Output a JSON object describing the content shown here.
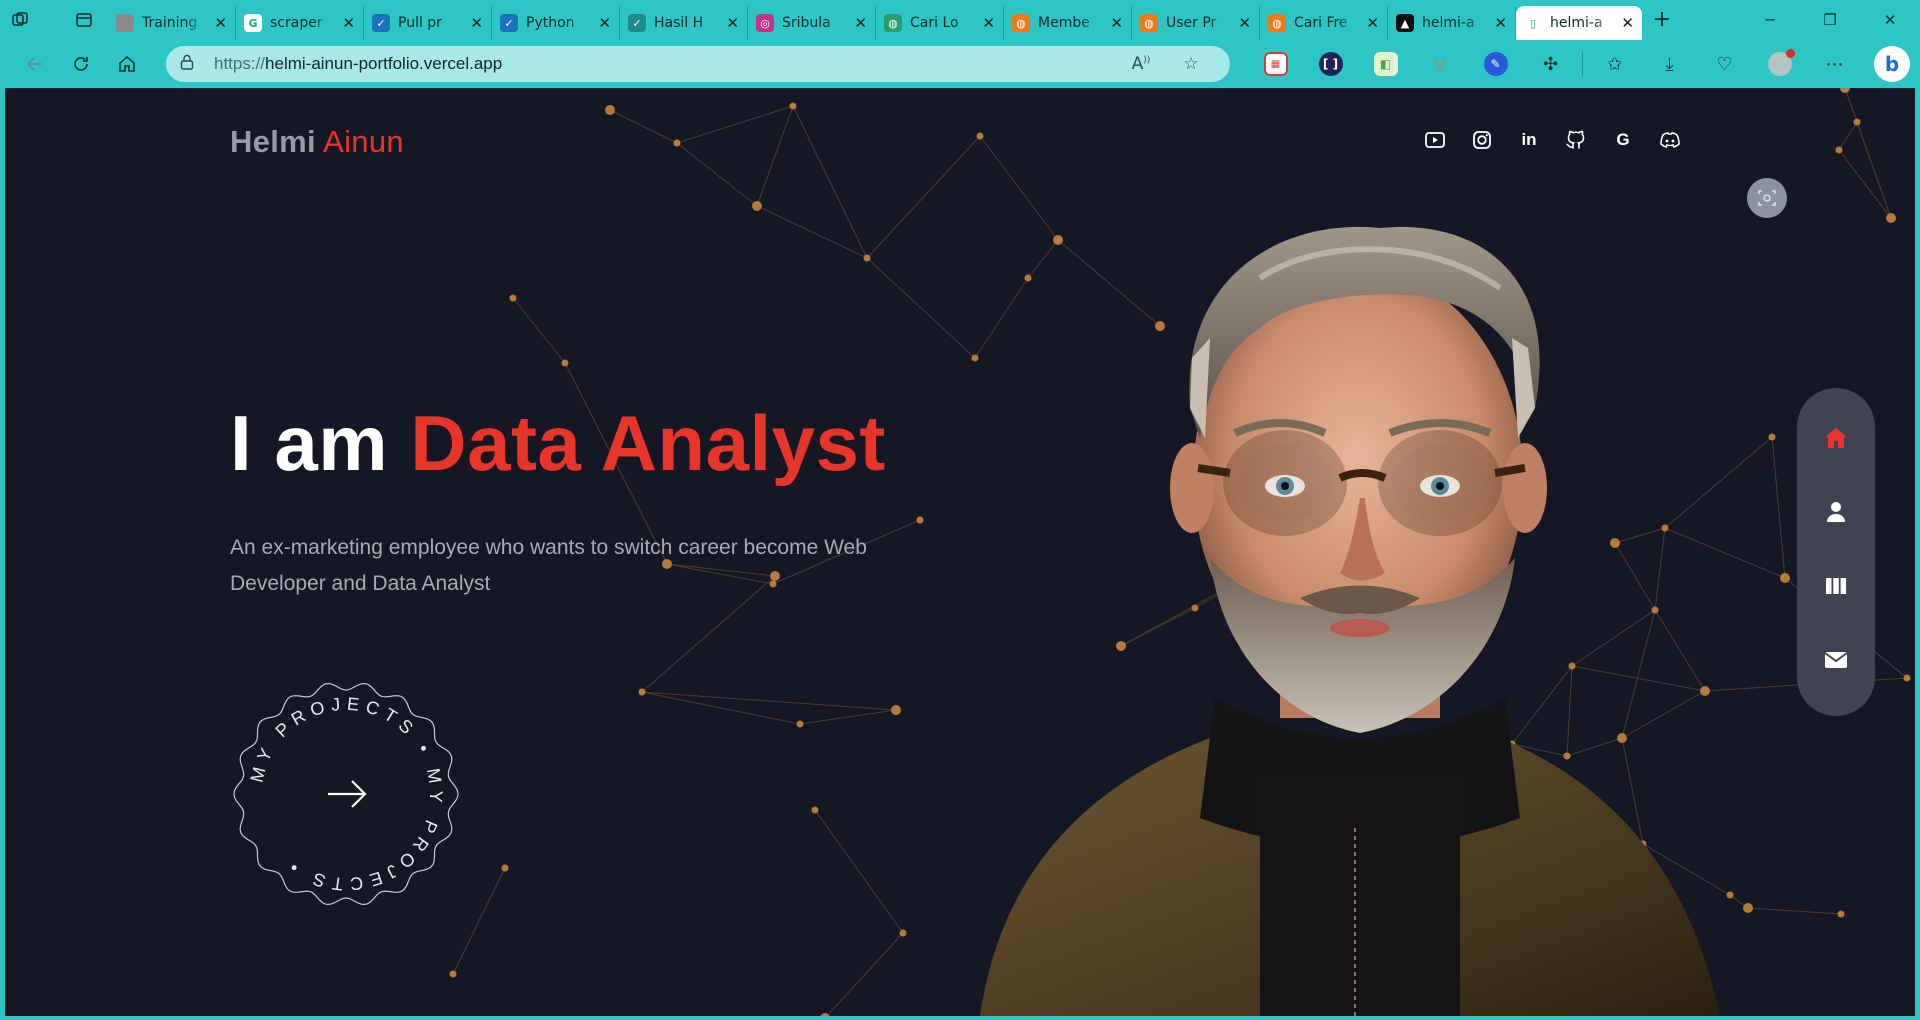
{
  "browser": {
    "tabs": [
      {
        "title": "Training",
        "favicon_color": "#8a8a8a",
        "glyph": "",
        "active": false
      },
      {
        "title": "scraper",
        "favicon_color": "#ffffff",
        "glyph": "G",
        "active": false
      },
      {
        "title": "Pull pr",
        "favicon_color": "#1a73b8",
        "glyph": "✓",
        "active": false
      },
      {
        "title": "Python",
        "favicon_color": "#1a73b8",
        "glyph": "✓",
        "active": false
      },
      {
        "title": "Hasil H",
        "favicon_color": "#1f8a8a",
        "glyph": "✓",
        "active": false
      },
      {
        "title": "Sribula",
        "favicon_color": "#c13584",
        "glyph": "◎",
        "active": false
      },
      {
        "title": "Cari Lo",
        "favicon_color": "#2a9d6f",
        "glyph": "◍",
        "active": false
      },
      {
        "title": "Membe",
        "favicon_color": "#f07a1a",
        "glyph": "◍",
        "active": false
      },
      {
        "title": "User Pr",
        "favicon_color": "#f07a1a",
        "glyph": "◍",
        "active": false
      },
      {
        "title": "Cari Fre",
        "favicon_color": "#f07a1a",
        "glyph": "◍",
        "active": false
      },
      {
        "title": "helmi-a",
        "favicon_color": "#111111",
        "glyph": "▲",
        "active": false
      },
      {
        "title": "helmi-a",
        "favicon_color": "#ffffff",
        "glyph": "▯",
        "active": true
      }
    ],
    "url_protocol": "https://",
    "url_host": "helmi-ainun-portfolio.vercel.app"
  },
  "site": {
    "brand_first": "Helmi",
    "brand_last": "Ainun",
    "social_icons": [
      "youtube-icon",
      "instagram-icon",
      "linkedin-icon",
      "github-icon",
      "google-icon",
      "discord-icon"
    ],
    "hero_prefix": "I am",
    "hero_role": "Data Analyst",
    "hero_description": "An ex-marketing employee who wants to switch career become Web Developer and Data Analyst",
    "projects_badge_text": "MY PROJECTS • MY PROJECTS •",
    "side_nav": [
      "home-icon",
      "user-icon",
      "projects-icon",
      "mail-icon"
    ],
    "accent_color": "#e8352a",
    "background_color": "#151725"
  }
}
